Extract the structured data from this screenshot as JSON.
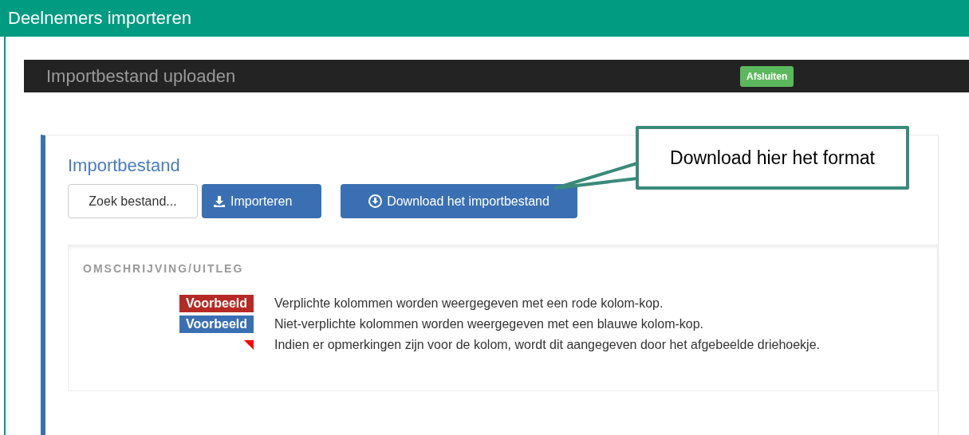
{
  "window": {
    "title": "Deelnemers importeren"
  },
  "toolbar": {
    "title": "Importbestand uploaden",
    "close_button": "Afsluiten"
  },
  "panel": {
    "title": "Importbestand",
    "file_button": "Zoek bestand...",
    "import_button": "Importeren",
    "download_button": "Download het importbestand"
  },
  "description": {
    "heading": "OMSCHRIJVING/UITLEG",
    "legend": [
      {
        "kind": "badge",
        "badge": "Voorbeeld",
        "color": "#b52a25",
        "text": "Verplichte kolommen worden weergegeven met een rode kolom-kop."
      },
      {
        "kind": "badge",
        "badge": "Voorbeeld",
        "color": "#3a70b3",
        "text": "Niet-verplichte kolommen worden weergegeven met een blauwe kolom-kop."
      },
      {
        "kind": "triangle",
        "color": "#ff0000",
        "text": "Indien er opmerkingen zijn voor de kolom, wordt dit aangegeven door het afgebeelde driehoekje."
      }
    ]
  },
  "callout": {
    "text": "Download hier het format"
  }
}
